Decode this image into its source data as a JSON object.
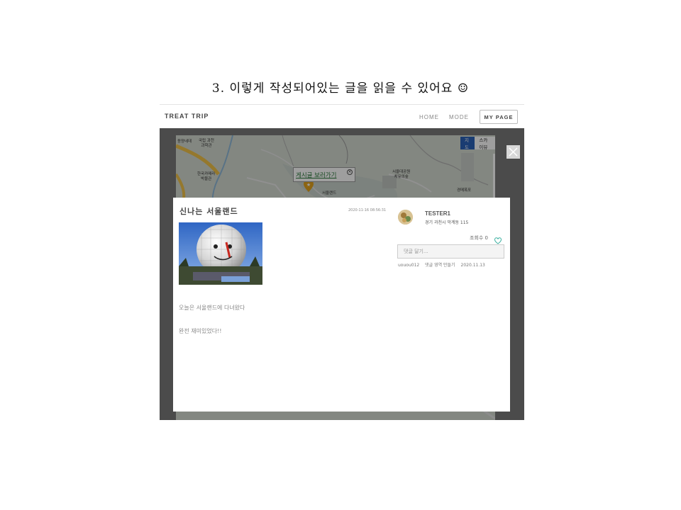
{
  "caption": "3. 이렇게 작성되어있는 글을 읽을 수 있어요 ☺",
  "navbar": {
    "brand": "TREAT TRIP",
    "home": "HOME",
    "mode": "MODE",
    "my_page": "MY PAGE"
  },
  "map": {
    "type_map": "지도",
    "type_skyview": "스카이뷰",
    "zoom_in": "+",
    "popup_link": "게시글 보러가기",
    "popup_close": "×",
    "labels": {
      "top_left": "동양네데",
      "museum1": "국립 과천\n과학관",
      "museum2": "한국카메라\n박물관",
      "park": "서울대공원\n치유의숲",
      "waterfall": "경메폭포",
      "seoulland": "서울랜드"
    }
  },
  "post": {
    "title": "신나는 서울랜드",
    "date": "2020-11-16 08:56:31",
    "body_line1": "오늘은 서울랜드에 다녀왔다",
    "body_line2": "완전 재미있었다!!"
  },
  "author": {
    "name": "TESTER1",
    "location": "경기 과천시 막계동 115",
    "views_label": "조회수 0"
  },
  "comment": {
    "placeholder": "댓글 달기...",
    "user": "uouou012",
    "text": "댓글 영역 만들기",
    "date": "2020.11.13"
  },
  "colors": {
    "accent_blue": "#2a62b8",
    "link_green": "#2a7a3a",
    "heart": "#3cb0a0"
  }
}
